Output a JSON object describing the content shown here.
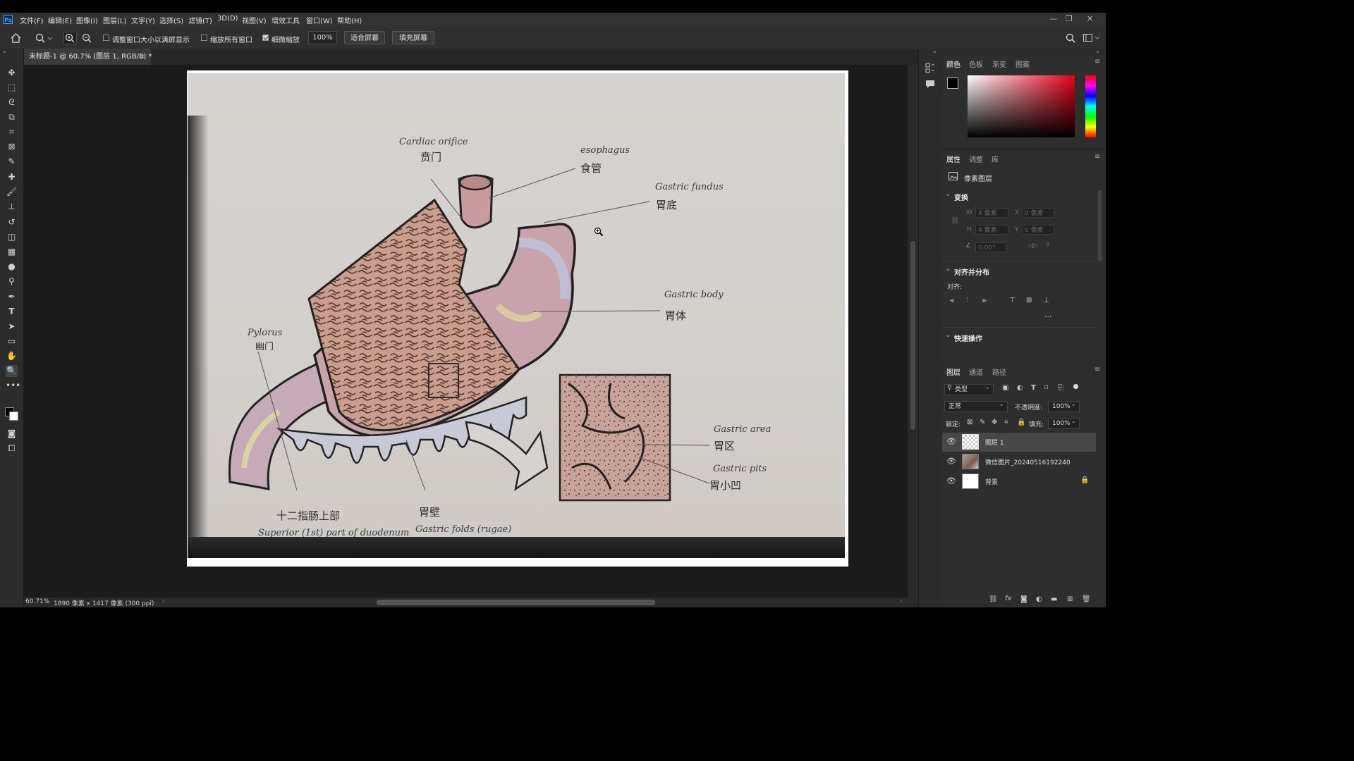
{
  "menu": {
    "items": [
      "文件(F)",
      "编辑(E)",
      "图像(I)",
      "图层(L)",
      "文字(Y)",
      "选择(S)",
      "滤镜(T)",
      "3D(D)",
      "视图(V)",
      "增效工具",
      "窗口(W)",
      "帮助(H)"
    ],
    "logo": "Ps",
    "window_controls": [
      "—",
      "❐",
      "✕"
    ]
  },
  "options": {
    "resize_windows": "调整窗口大小以满屏显示",
    "zoom_all": "缩放所有窗口",
    "scrubby_zoom": "细微缩放",
    "zoom_value": "100%",
    "fit_screen": "适合屏幕",
    "fill_screen": "填充屏幕"
  },
  "document": {
    "tab_title": "未标题-1 @ 60.7% (图层 1, RGB/8) *",
    "tab_close": "×"
  },
  "drawing": {
    "cardiac_en": "Cardiac orifice",
    "cardiac_cn": "贲门",
    "esophagus_en": "esophagus",
    "esophagus_cn": "食管",
    "fundus_en": "Gastric fundus",
    "fundus_cn": "胃底",
    "body_en": "Gastric body",
    "body_cn": "胃体",
    "pylorus_en": "Pylorus",
    "pylorus_cn": "幽门",
    "duodenum_cn": "十二指肠上部",
    "duodenum_en": "Superior (1st) part of duodenum",
    "wall_cn": "胃壁",
    "rugae_en": "Gastric folds (rugae)",
    "area_en": "Gastric area",
    "area_cn": "胃区",
    "pits_en": "Gastric pits",
    "pits_cn": "胃小凹"
  },
  "status": {
    "zoom": "60.71%",
    "doc_info": "1890 像素 x 1417 像素 (300 ppi)"
  },
  "color_panel": {
    "tabs": [
      "颜色",
      "色板",
      "渐变",
      "图案"
    ]
  },
  "properties_panel": {
    "tabs": [
      "属性",
      "调整",
      "库"
    ],
    "layer_type": "像素图层",
    "transform_title": "变换",
    "w_label": "W",
    "w_value": "4 像素",
    "h_label": "H",
    "h_value": "4 像素",
    "x_label": "X",
    "x_value": "0 像素",
    "y_label": "Y",
    "y_value": "0 像素",
    "angle_value": "0.00°",
    "align_title": "对齐并分布",
    "align_label": "对齐:",
    "more": "...",
    "quick_title": "快速操作"
  },
  "layers_panel": {
    "tabs": [
      "图层",
      "通道",
      "路径"
    ],
    "filter_label": "类型",
    "blend_mode": "正常",
    "opacity_label": "不透明度:",
    "opacity_value": "100%",
    "lock_label": "锁定:",
    "fill_label": "填充:",
    "fill_value": "100%",
    "layers": [
      {
        "name": "图层 1",
        "selected": true
      },
      {
        "name": "微信图片_20240516192240",
        "selected": false
      },
      {
        "name": "背景",
        "selected": false,
        "locked": true
      }
    ]
  },
  "colors": {
    "accent": "#31a8ff",
    "panel_bg": "#2b2b2b",
    "canvas_bg": "#1b1b1b"
  }
}
